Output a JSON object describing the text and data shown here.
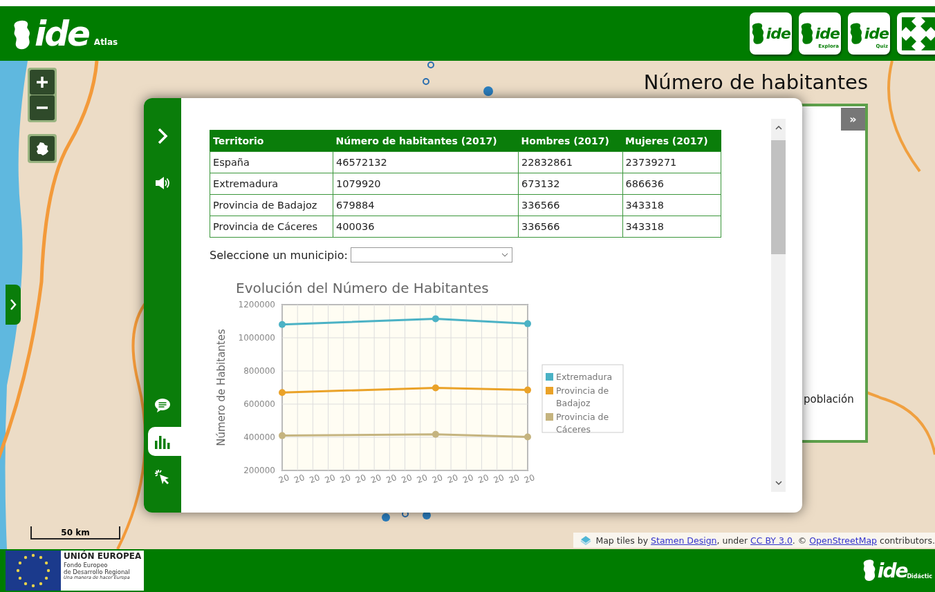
{
  "header": {
    "logo": {
      "mark": "ide",
      "caption": "Atlas"
    },
    "apps": [
      {
        "kind": "app",
        "mark": "ide"
      },
      {
        "kind": "app",
        "mark": "ide",
        "caption": "Explora"
      },
      {
        "kind": "app",
        "mark": "ide",
        "caption": "Quiz"
      },
      {
        "kind": "fullscreen"
      }
    ]
  },
  "map": {
    "title": "Número de habitantes",
    "scale": "50 km",
    "attribution": [
      {
        "kind": "text",
        "text": "Map tiles by "
      },
      {
        "kind": "link",
        "text": "Stamen Design"
      },
      {
        "kind": "text",
        "text": ", under "
      },
      {
        "kind": "link",
        "text": "CC BY 3.0"
      },
      {
        "kind": "text",
        "text": ". © "
      },
      {
        "kind": "link",
        "text": "OpenStreetMap"
      },
      {
        "kind": "text",
        "text": " contributors."
      }
    ]
  },
  "side_panel": {
    "toggle": "»",
    "text": "población"
  },
  "dialog": {
    "sidebar": {
      "top": [
        {
          "kind": "chevron",
          "selected": false
        },
        {
          "kind": "speaker",
          "selected": false
        }
      ],
      "bottom": [
        {
          "kind": "comment",
          "selected": false
        },
        {
          "kind": "bar-chart",
          "selected": true
        },
        {
          "kind": "pointer",
          "selected": false
        }
      ]
    },
    "table": {
      "columns": [
        "Territorio",
        "Número de habitantes (2017)",
        "Hombres (2017)",
        "Mujeres (2017)"
      ],
      "rows": [
        [
          "España",
          "46572132",
          "22832861",
          "23739271"
        ],
        [
          "Extremadura",
          "1079920",
          "673132",
          "686636"
        ],
        [
          "Provincia de Badajoz",
          "679884",
          "336566",
          "343318"
        ],
        [
          "Provincia de Cáceres",
          "400036",
          "336566",
          "343318"
        ]
      ]
    },
    "municipio": {
      "label": "Seleccione un municipio:"
    },
    "chart_data": {
      "type": "line",
      "title": "Evolución del Número de Habitantes",
      "ylabel": "Número de Habitantes",
      "categories": [
        "20",
        "20",
        "20",
        "20",
        "20",
        "20",
        "20",
        "20",
        "20",
        "20",
        "20",
        "20",
        "20",
        "20",
        "20",
        "20",
        "20"
      ],
      "series": [
        {
          "name": "Extremadura",
          "color": "#4bb2c5",
          "marker": true,
          "values": [
            1080000,
            null,
            null,
            null,
            null,
            null,
            null,
            null,
            null,
            null,
            1115000,
            null,
            null,
            null,
            null,
            null,
            1085000
          ]
        },
        {
          "name": "Provincia de Badajoz",
          "color": "#eaa228",
          "marker": true,
          "values": [
            670000,
            null,
            null,
            null,
            null,
            null,
            null,
            null,
            null,
            null,
            698000,
            null,
            null,
            null,
            null,
            null,
            685000
          ]
        },
        {
          "name": "Provincia de Cáceres",
          "color": "#c5b47f",
          "marker": true,
          "values": [
            410000,
            null,
            null,
            null,
            null,
            null,
            null,
            null,
            null,
            null,
            418000,
            null,
            null,
            null,
            null,
            null,
            402000
          ]
        }
      ],
      "ylim": [
        200000,
        1200000
      ],
      "grid": true,
      "legend": "right",
      "yticks": [
        200000,
        400000,
        600000,
        800000,
        1000000,
        1200000
      ]
    }
  },
  "footer": {
    "eu": {
      "title": "UNIÓN EUROPEA",
      "lines": [
        "Fondo Europeo",
        "de Desarrollo Regional"
      ],
      "motto": "Una manera de hacer Europa"
    },
    "logo": {
      "mark": "ide",
      "caption": "Didáctic"
    }
  }
}
